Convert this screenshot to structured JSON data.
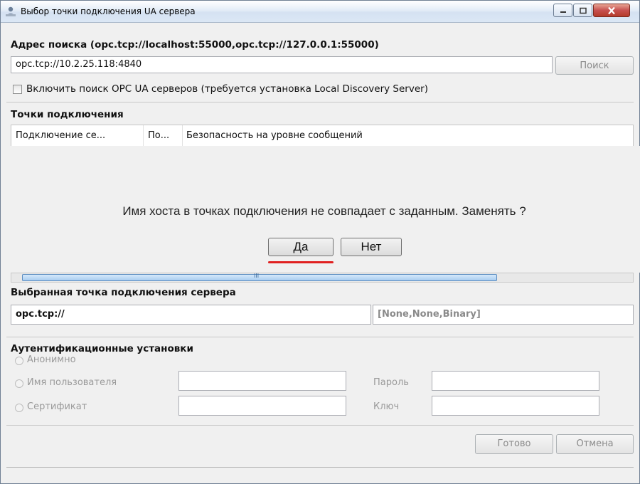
{
  "window": {
    "title": "Выбор точки подключения UA сервера",
    "controls": {
      "minimize": "minimize-icon",
      "maximize": "maximize-icon",
      "close": "close-icon"
    }
  },
  "search": {
    "heading": "Адрес поиска (opc.tcp://localhost:55000,opc.tcp://127.0.0.1:55000)",
    "value": "opc.tcp://10.2.25.118:4840",
    "button": "Поиск",
    "discovery_label": "Включить поиск OPC UA серверов (требуется установка Local Discovery Server)"
  },
  "endpoints": {
    "heading": "Точки подключения",
    "columns": [
      "Подключение се...",
      "По...",
      "Безопасность на уровне сообщений"
    ]
  },
  "prompt": {
    "message": "Имя хоста в точках подключения не совпадает с заданным. Заменять ?",
    "yes": "Да",
    "no": "Нет",
    "highlight_color": "#e02020"
  },
  "scrollbar": {
    "thumb_grip": "III"
  },
  "selected": {
    "heading": "Выбранная точка подключения сервера",
    "url": "opc.tcp://",
    "security": "[None,None,Binary]"
  },
  "auth": {
    "heading": "Аутентификационные установки",
    "anonymous": "Анонимно",
    "username": "Имя пользователя",
    "password": "Пароль",
    "certificate": "Сертификат",
    "key": "Ключ"
  },
  "footer": {
    "ok": "Готово",
    "cancel": "Отмена"
  }
}
